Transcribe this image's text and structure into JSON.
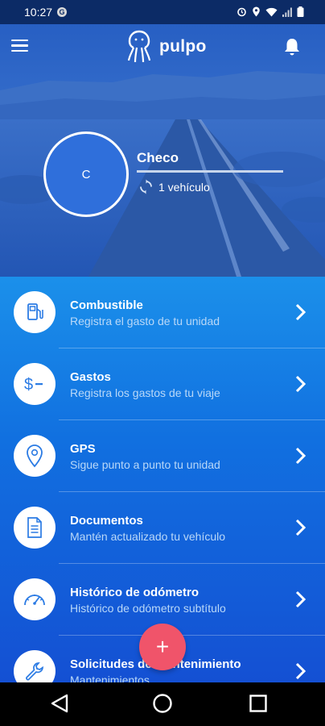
{
  "status_bar": {
    "time": "10:27",
    "notification_badge": "G"
  },
  "app_bar": {
    "logo_text": "pulpo",
    "menu_icon": "hamburger-menu-icon",
    "notifications_icon": "bell-icon"
  },
  "profile": {
    "avatar_initial": "C",
    "name": "Checo",
    "vehicles": "1 vehículo"
  },
  "menu_items": [
    {
      "title": "Combustible",
      "subtitle": "Registra el gasto de tu unidad",
      "icon": "fuel-pump-icon"
    },
    {
      "title": "Gastos",
      "subtitle": "Registra los gastos de tu viaje",
      "icon": "dollar-minus-icon"
    },
    {
      "title": "GPS",
      "subtitle": "Sigue punto a punto tu unidad",
      "icon": "location-pin-icon"
    },
    {
      "title": "Documentos",
      "subtitle": "Mantén actualizado tu vehículo",
      "icon": "document-icon"
    },
    {
      "title": "Histórico de odómetro",
      "subtitle": "Histórico de odómetro subtítulo",
      "icon": "speedometer-icon"
    },
    {
      "title": "Solicitudes de mantenimiento",
      "subtitle": "Mantenimientos",
      "icon": "wrench-icon"
    }
  ],
  "fab": {
    "label": "+"
  },
  "colors": {
    "accent": "#f0546a",
    "primary": "#1660d8",
    "icon_blue": "#2b7be4"
  }
}
